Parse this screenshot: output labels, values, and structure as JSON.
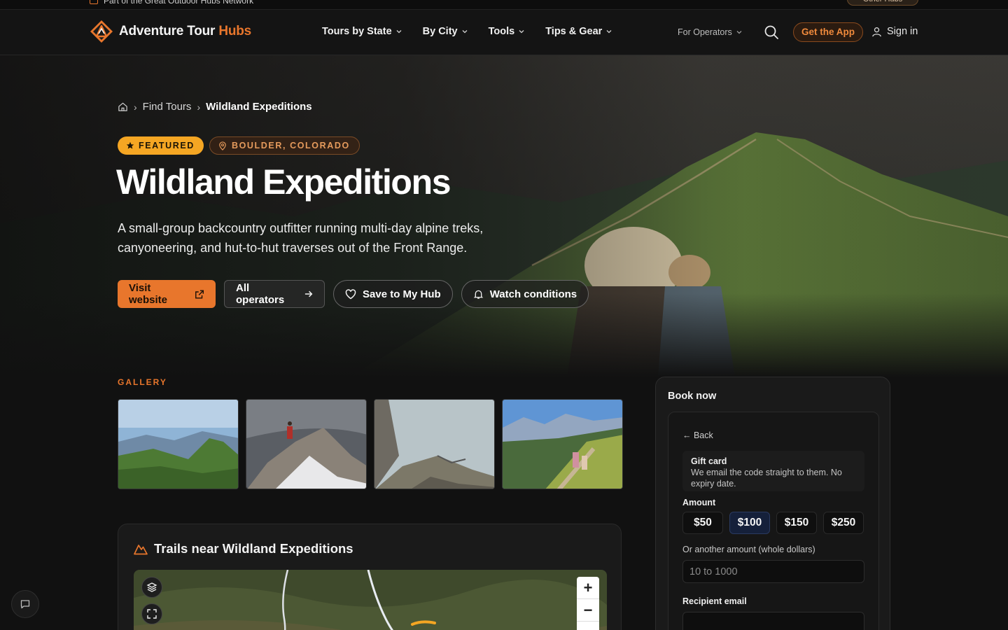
{
  "network": {
    "text": "Part of the Great Outdoor Hubs Network",
    "other_hubs": "Other Hubs"
  },
  "brand": {
    "name_main": "Adventure Tour",
    "name_accent": "Hubs",
    "accent_color": "#e8762c"
  },
  "nav": {
    "items": [
      {
        "label": "Tours by State"
      },
      {
        "label": "By City"
      },
      {
        "label": "Tools"
      },
      {
        "label": "Tips & Gear"
      }
    ],
    "operators": "For Operators",
    "get_app": "Get the App",
    "sign_in": "Sign in"
  },
  "breadcrumb": {
    "level1": "Find Tours",
    "current": "Wildland Expeditions"
  },
  "badges": {
    "featured": "FEATURED",
    "location": "BOULDER, COLORADO"
  },
  "hero": {
    "title": "Wildland Expeditions",
    "description": "A small-group backcountry outfitter running multi-day alpine treks, canyoneering, and hut-to-hut traverses out of the Front Range."
  },
  "actions": {
    "visit": "Visit website",
    "operators": "All operators",
    "save": "Save to My Hub",
    "watch": "Watch conditions"
  },
  "gallery": {
    "label": "GALLERY"
  },
  "trails": {
    "title": "Trails near Wildland Expeditions"
  },
  "book": {
    "title": "Book now",
    "back": "← Back",
    "gift_title": "Gift card",
    "gift_desc": "We email the code straight to them. No expiry date.",
    "amount_label": "Amount",
    "amounts": [
      "$50",
      "$100",
      "$150",
      "$250"
    ],
    "selected_amount": "$100",
    "other_label": "Or another amount (whole dollars)",
    "other_placeholder": "10 to 1000",
    "email_label": "Recipient email"
  }
}
